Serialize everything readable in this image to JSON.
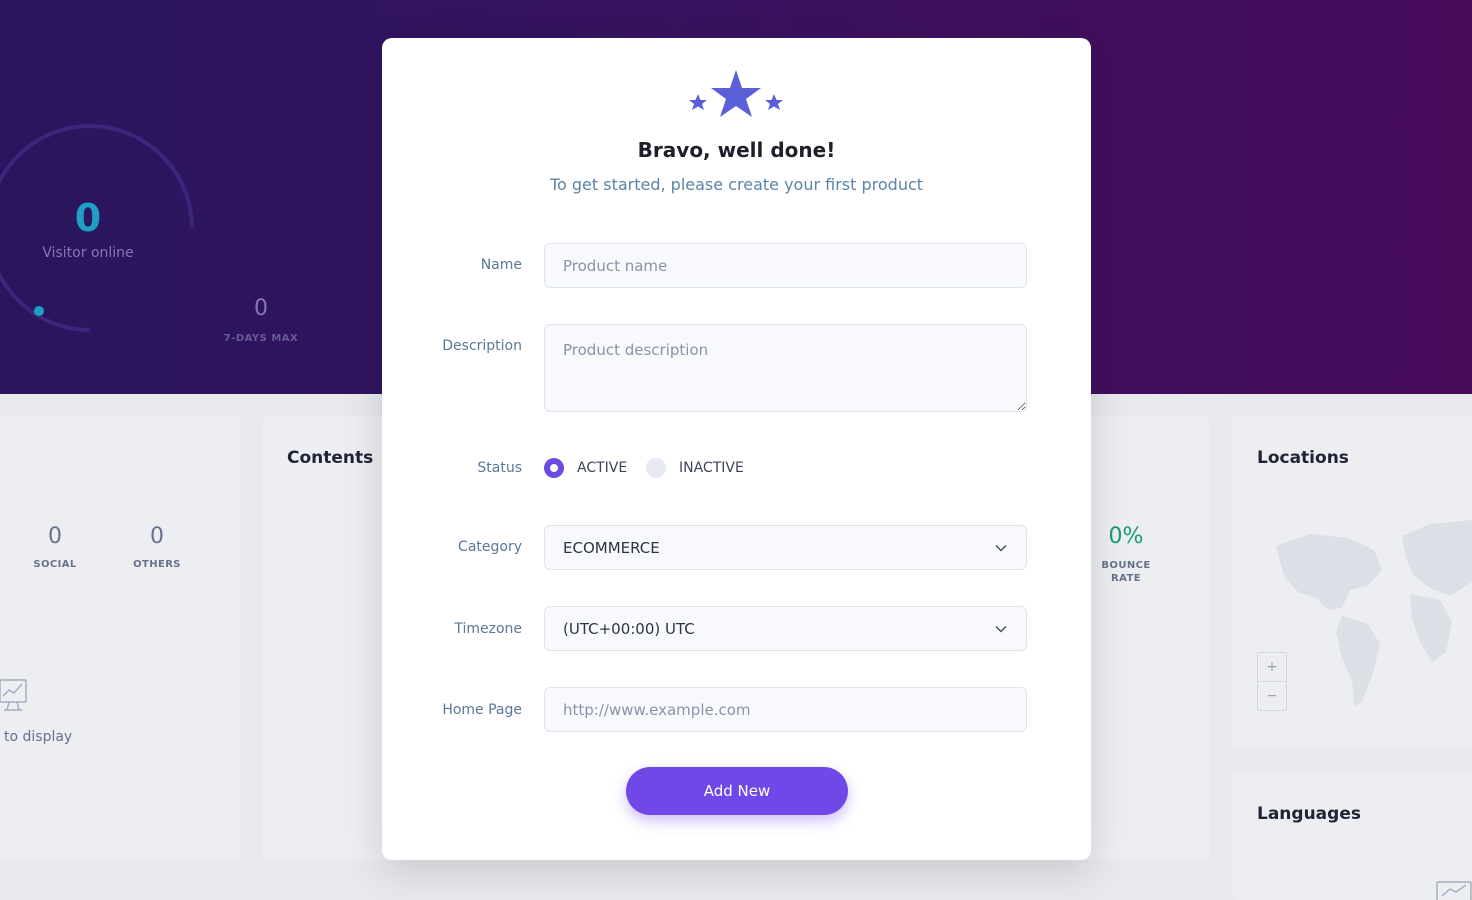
{
  "dashboard": {
    "visitor": {
      "value": "0",
      "label": "Visitor online"
    },
    "max7": {
      "value": "0",
      "label": "7-DAYS MAX"
    },
    "sources": [
      {
        "value": "0",
        "label": "SOCIAL"
      },
      {
        "value": "0",
        "label": "OTHERS"
      }
    ],
    "empty_text": "to display",
    "contents_title": "Contents",
    "bounce": {
      "value": "0%",
      "label": "BOUNCE RATE",
      "color": "#1a9e7a"
    },
    "locations_title": "Locations",
    "map_zoom": {
      "plus": "+",
      "minus": "−"
    },
    "languages_title": "Languages"
  },
  "modal": {
    "title": "Bravo, well done!",
    "subtitle": "To get started, please create your first product",
    "icon": "stars-icon",
    "form": {
      "name": {
        "label": "Name",
        "placeholder": "Product name",
        "value": ""
      },
      "description": {
        "label": "Description",
        "placeholder": "Product description",
        "value": ""
      },
      "status": {
        "label": "Status",
        "options": [
          "ACTIVE",
          "INACTIVE"
        ],
        "selected": "ACTIVE"
      },
      "category": {
        "label": "Category",
        "value": "ECOMMERCE"
      },
      "timezone": {
        "label": "Timezone",
        "value": "(UTC+00:00) UTC"
      },
      "homepage": {
        "label": "Home Page",
        "placeholder": "http://www.example.com",
        "value": ""
      }
    },
    "submit_label": "Add New"
  },
  "colors": {
    "accent": "#7048e8",
    "hero_start": "#2a1660",
    "hero_end": "#4a0c5c",
    "visitor": "#1fa4c8"
  }
}
